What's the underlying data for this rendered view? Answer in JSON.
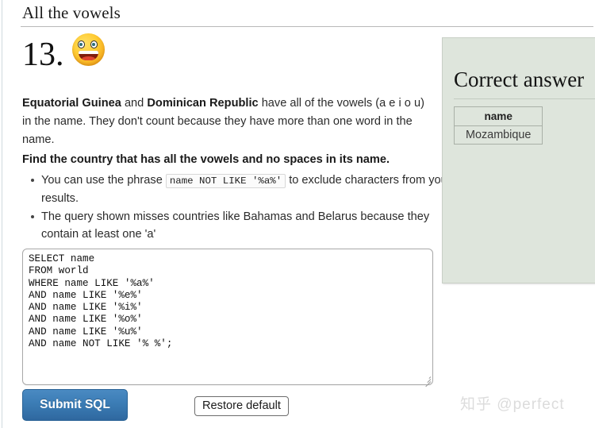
{
  "page": {
    "title": "All the vowels",
    "question_number": "13.",
    "emoji": "grinning-face-emoji"
  },
  "content": {
    "intro_bold_1": "Equatorial Guinea",
    "intro_mid": " and ",
    "intro_bold_2": "Dominican Republic",
    "intro_rest": " have all of the vowels (a e i o u) in the name. They don't count because they have more than one word in the name.",
    "task": "Find the country that has all the vowels and no spaces in its name.",
    "hints": [
      {
        "before": "You can use the phrase ",
        "code": "name NOT LIKE '%a%'",
        "after": " to exclude characters from your results."
      },
      {
        "before": "The query shown misses countries like Bahamas and Belarus because they contain at least one 'a'",
        "code": "",
        "after": ""
      }
    ]
  },
  "editor": {
    "sql": "SELECT name\nFROM world\nWHERE name LIKE '%a%'\nAND name LIKE '%e%'\nAND name LIKE '%i%'\nAND name LIKE '%o%'\nAND name LIKE '%u%'\nAND name NOT LIKE '% %';"
  },
  "buttons": {
    "submit_label": "Submit SQL",
    "restore_label": "Restore default"
  },
  "answer_panel": {
    "heading": "Correct answer",
    "table": {
      "headers": [
        "name"
      ],
      "rows": [
        [
          "Mozambique"
        ]
      ]
    }
  },
  "watermark": {
    "text": "知乎 @perfect"
  },
  "colors": {
    "accent_blue": "#3b7cb5",
    "panel_green": "#dee5dc",
    "text": "#2b2b2b",
    "watermark": "#dcdcdc"
  }
}
